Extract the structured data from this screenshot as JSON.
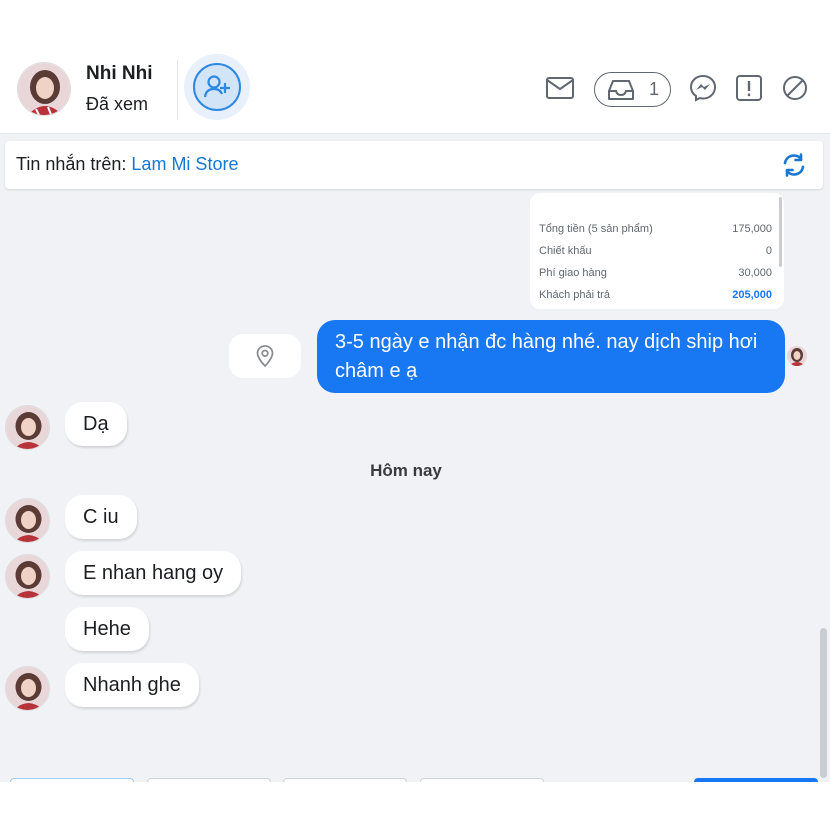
{
  "header": {
    "contact_name": "Nhi Nhi",
    "status": "Đã xem",
    "inbox_count": "1"
  },
  "info_bar": {
    "prefix": "Tin nhắn trên:",
    "store": "Lam Mi Store"
  },
  "order_card": {
    "rows": [
      {
        "label": "Tổng tiền (5 sản phẩm)",
        "value": "175,000"
      },
      {
        "label": "Chiết khấu",
        "value": "0"
      },
      {
        "label": "Phí giao hàng",
        "value": "30,000"
      },
      {
        "label": "Khách phải trả",
        "value": "205,000"
      }
    ]
  },
  "messages": {
    "outgoing_1": "3-5 ngày e nhận đc hàng nhé. nay dịch ship hơi châm e ạ",
    "incoming_1": "Dạ",
    "date_separator": "Hôm nay",
    "incoming_2": "C iu",
    "incoming_3": "E nhan hang oy",
    "incoming_4": "Hehe",
    "incoming_5": "Nhanh ghe"
  },
  "colors": {
    "accent": "#1877f2",
    "background": "#f0f2f5",
    "bubble_in": "#ffffff"
  },
  "icons": [
    "add-friend-icon",
    "mail-icon",
    "inbox-icon",
    "messenger-icon",
    "report-icon",
    "block-icon",
    "refresh-icon",
    "location-pin-icon"
  ]
}
